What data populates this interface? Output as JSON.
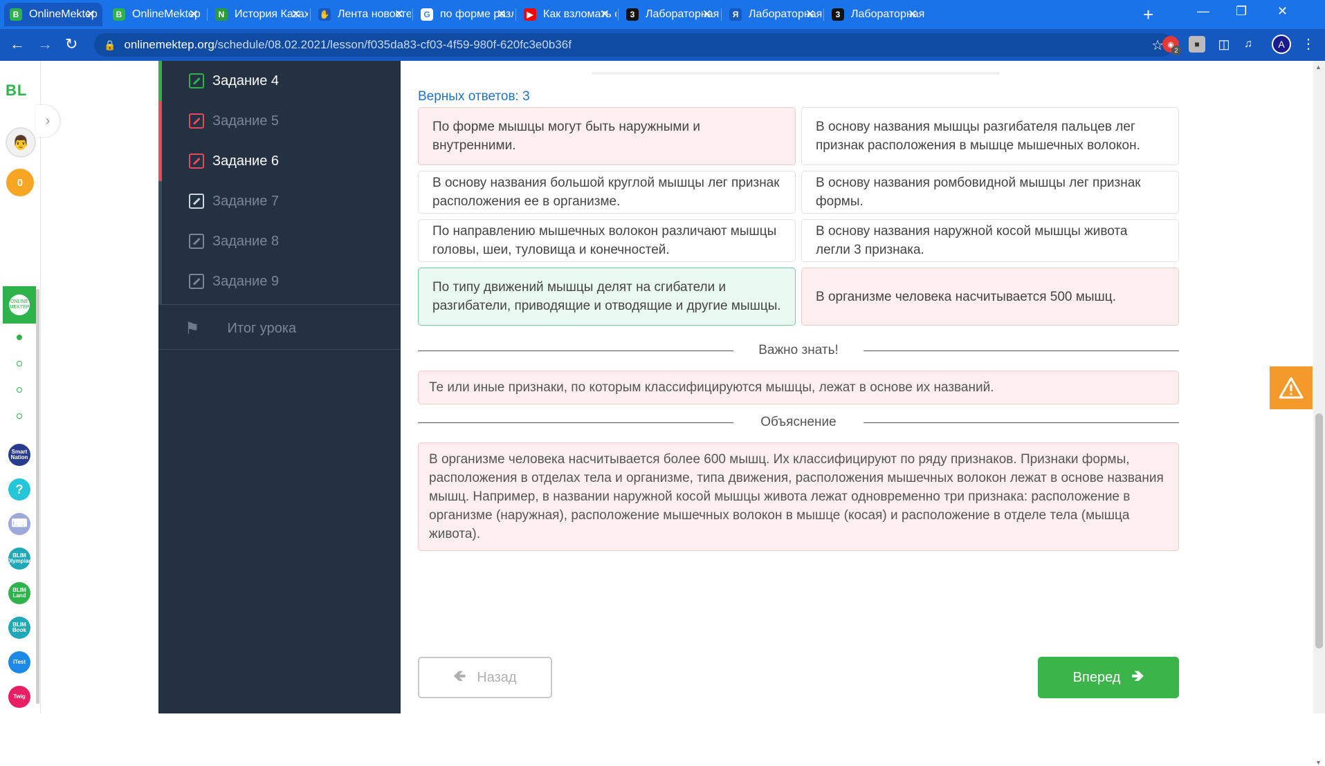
{
  "browser": {
    "tabs": [
      {
        "label": "OnlineMektep",
        "icon": "onlinemektep-icon",
        "fav": "B",
        "color": "#2eb34a",
        "active": true
      },
      {
        "label": "OnlineMektep",
        "icon": "onlinemektep-icon",
        "fav": "B",
        "color": "#2eb34a",
        "active": false
      },
      {
        "label": "История Казах",
        "icon": "n-logo-icon",
        "fav": "N",
        "color": "#2d9a3b",
        "active": false
      },
      {
        "label": "Лента новосте",
        "icon": "news-feed-icon",
        "fav": "✋",
        "color": "#1558c0",
        "active": false
      },
      {
        "label": "по форме разл",
        "icon": "google-icon",
        "fav": "G",
        "color": "#ffffff",
        "active": false
      },
      {
        "label": "Как взломать с",
        "icon": "youtube-icon",
        "fav": "▶",
        "color": "#ff0000",
        "active": false
      },
      {
        "label": "Лабораторная",
        "icon": "zaochnik-icon",
        "fav": "3",
        "color": "#111111",
        "active": false
      },
      {
        "label": "Лабораторная",
        "icon": "yandex-icon",
        "fav": "Я",
        "color": "#1558c0",
        "active": false
      },
      {
        "label": "Лабораторная",
        "icon": "zaochnik-icon",
        "fav": "3",
        "color": "#111111",
        "active": false
      }
    ],
    "new_tab": "+",
    "url_host": "onlinemektep.org",
    "url_path": "/schedule/08.02.2021/lesson/f035da83-cf03-4f59-980f-620fc3e0b36f",
    "profile_initial": "A",
    "extension_badge": "2"
  },
  "rail": {
    "logo": "BL",
    "coins": "0",
    "apps": [
      "Smart Nation",
      "?",
      "⌨",
      "BLIM Olympiad",
      "BLIM Land",
      "BLIM Book",
      "iTest",
      "Twig"
    ]
  },
  "sidebar": {
    "items": [
      {
        "label": "Задание 4",
        "state": "done"
      },
      {
        "label": "Задание 5",
        "state": "wrong-dim"
      },
      {
        "label": "Задание 6",
        "state": "wrong-current"
      },
      {
        "label": "Задание 7",
        "state": "dim"
      },
      {
        "label": "Задание 8",
        "state": "dim"
      },
      {
        "label": "Задание 9",
        "state": "dim"
      }
    ],
    "summary": "Итог урока"
  },
  "main": {
    "correct_count": "Верных ответов: 3",
    "answers": [
      {
        "text": "По форме мышцы могут быть наружными и внутренними.",
        "status": "wrong"
      },
      {
        "text": "В основу названия мышцы разгибателя пальцев лег признак расположения в мышце мышечных волокон.",
        "status": "neutral"
      },
      {
        "text": "В основу названия большой круглой мышцы лег признак расположения ее в организме.",
        "status": "neutral"
      },
      {
        "text": "В основу названия ромбовидной мышцы лег признак формы.",
        "status": "neutral"
      },
      {
        "text": "По направлению мышечных волокон различают мышцы головы, шеи, туловища и конечностей.",
        "status": "neutral"
      },
      {
        "text": "В основу названия наружной косой мышцы живота легли 3 признака.",
        "status": "neutral"
      },
      {
        "text": "По типу движений мышцы делят на сгибатели и разгибатели, приводящие и отводящие и другие мышцы.",
        "status": "right"
      },
      {
        "text": "В организме человека насчитывается 500 мышц.",
        "status": "wrong"
      }
    ],
    "important_title": "Важно знать!",
    "important_text": "Те или иные признаки, по которым классифицируются мышцы, лежат в основе их названий.",
    "explanation_title": "Объяснение",
    "explanation_text": "В организме человека насчитывается более 600 мышц. Их классифицируют по ряду признаков. Признаки формы, расположения в отделах тела и организме, типа движения, расположения мышечных волокон лежат в основе названия мышц. Например, в названии наружной косой мышцы живота лежат одновременно три признака: расположение в организме (наружная), расположение мышечных волокон в мышце (косая) и расположение в отделе тела (мышца живота).",
    "back_label": "Назад",
    "next_label": "Вперед"
  },
  "colors": {
    "accent": "#2eb34a",
    "tabbar": "#1a73e8",
    "sidebar": "#233142",
    "wrong_bg": "#fdeff0",
    "right_bg": "#eaf8f2",
    "warning": "#f39a2b",
    "link": "#1f72c4"
  }
}
